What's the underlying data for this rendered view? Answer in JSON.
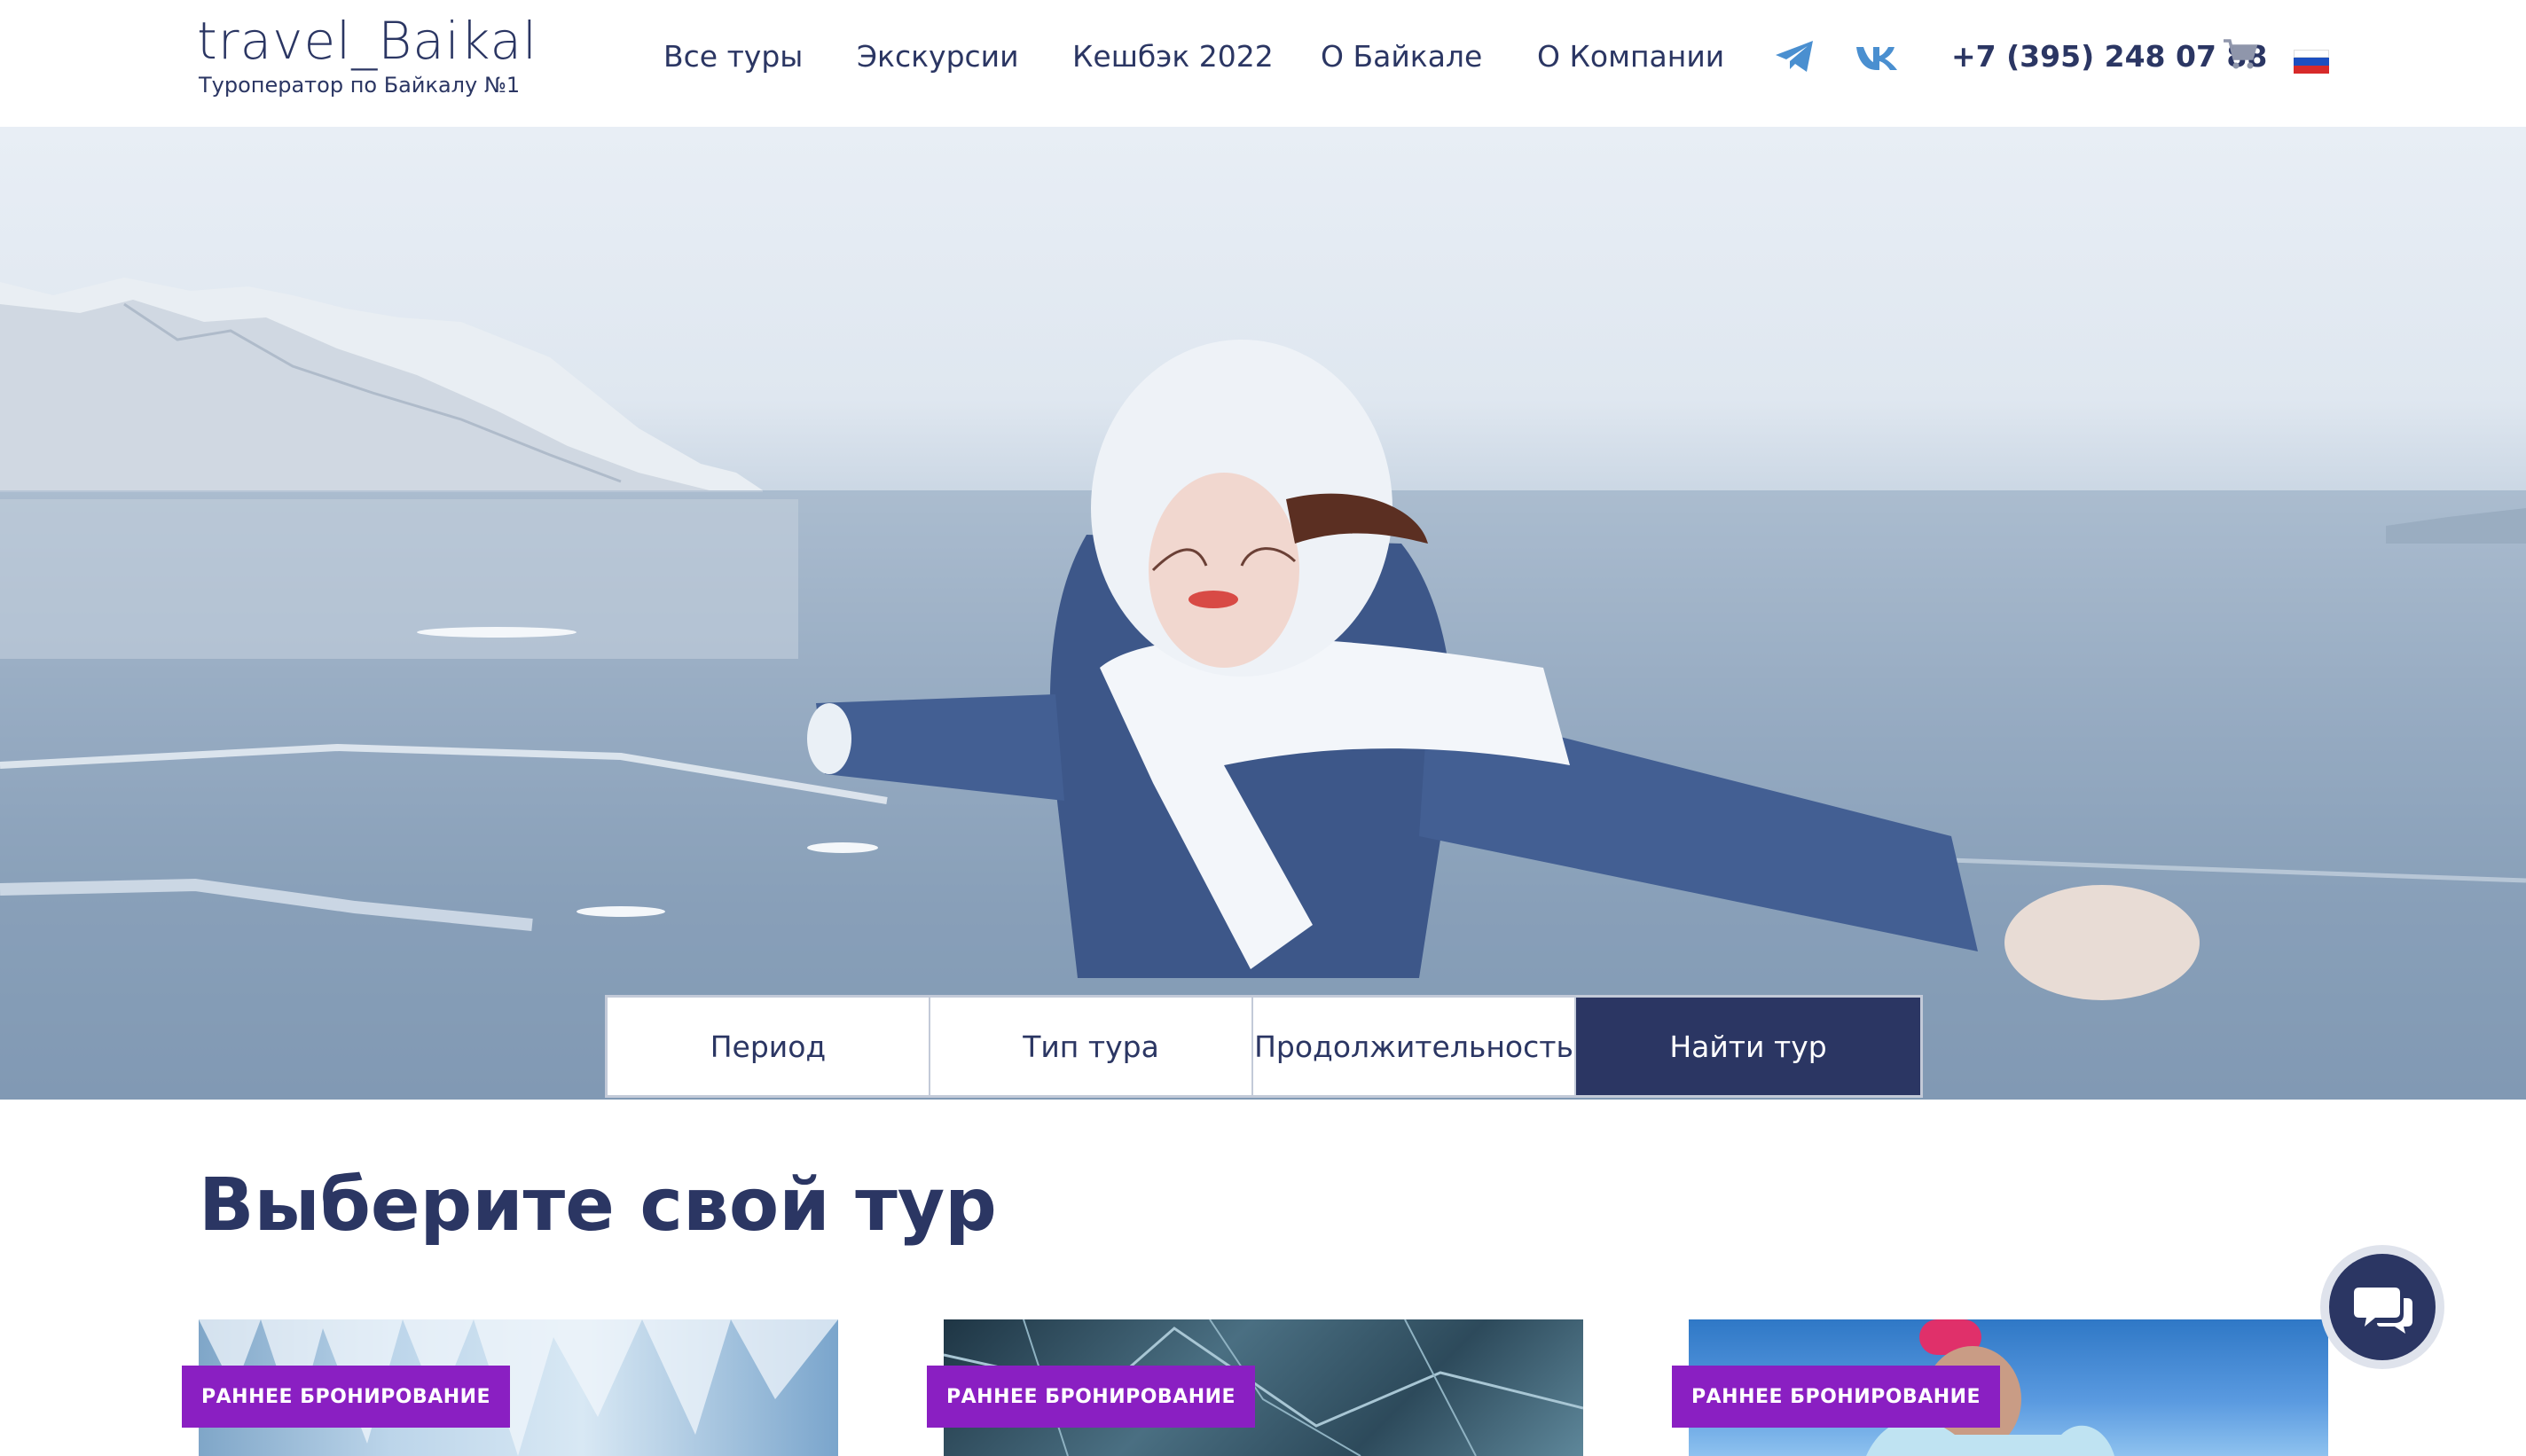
{
  "header": {
    "logo_text": "travel_Baikal",
    "tagline": "Туроператор по Байкалу №1",
    "nav": [
      "Все туры",
      "Экскурсии",
      "Кешбэк 2022",
      "О Байкале",
      "О Компании"
    ],
    "social_icons": [
      "telegram-icon",
      "vk-icon"
    ],
    "phone": "+7 (395) 248 07 88",
    "cart_icon": "cart-icon",
    "language_flag": "russia-flag-icon"
  },
  "search": {
    "period": "Период",
    "tour_type": "Тип тура",
    "duration": "Продолжительность",
    "find_button": "Найти тур"
  },
  "section": {
    "title": "Выберите свой тур"
  },
  "cards": [
    {
      "badge": "РАННЕЕ БРОНИРОВАНИЕ"
    },
    {
      "badge": "РАННЕЕ БРОНИРОВАНИЕ"
    },
    {
      "badge": "РАННЕЕ БРОНИРОВАНИЕ"
    }
  ],
  "chat_icon": "chat-icon",
  "colors": {
    "brand_navy": "#2b3663",
    "badge_purple": "#8a1fc2",
    "social_blue": "#4a8fd0"
  }
}
